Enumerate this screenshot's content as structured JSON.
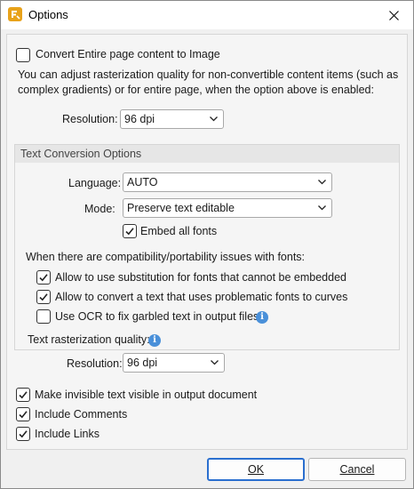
{
  "window": {
    "title": "Options"
  },
  "convert_page": {
    "label": "Convert Entire page content to Image",
    "checked": false
  },
  "description": "You can adjust rasterization quality for non-convertible content items (such as complex gradients) or for entire page, when the option above is enabled:",
  "page_resolution": {
    "label": "Resolution:",
    "value": "96 dpi"
  },
  "text_conversion": {
    "header": "Text Conversion Options",
    "language": {
      "label": "Language:",
      "value": "AUTO"
    },
    "mode": {
      "label": "Mode:",
      "value": "Preserve text editable"
    },
    "embed_fonts": {
      "label": "Embed all fonts",
      "checked": true
    },
    "issues_label": "When there are compatibility/portability issues with fonts:",
    "substitution": {
      "label": "Allow to use substitution for fonts that cannot be embedded",
      "checked": true
    },
    "curves": {
      "label": "Allow to convert a text that uses problematic fonts to curves",
      "checked": true
    },
    "ocr": {
      "label": "Use OCR to fix garbled text in output files.",
      "checked": false
    },
    "raster_quality_label": "Text rasterization quality:",
    "resolution": {
      "label": "Resolution:",
      "value": "96 dpi"
    }
  },
  "invisible_text": {
    "label": "Make invisible text visible in output document",
    "checked": true
  },
  "include_comments": {
    "label": "Include Comments",
    "checked": true
  },
  "include_links": {
    "label": "Include Links",
    "checked": true
  },
  "buttons": {
    "ok": "OK",
    "cancel": "Cancel"
  },
  "colors": {
    "accent": "#2a6fcf",
    "info": "#4a90d9",
    "app_icon": "#e8a21a"
  }
}
